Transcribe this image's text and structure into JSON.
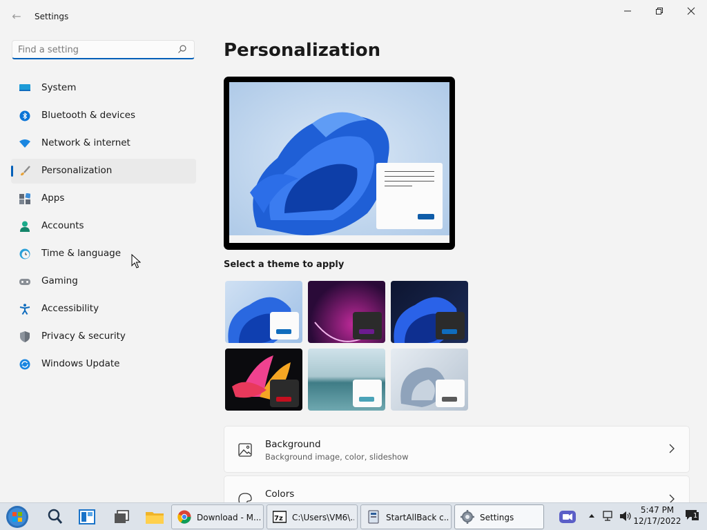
{
  "window": {
    "title": "Settings",
    "back_glyph": "←",
    "controls": {
      "minimize": "—",
      "maximize": "☐",
      "close": "✕"
    }
  },
  "search": {
    "placeholder": "Find a setting",
    "value": ""
  },
  "nav": {
    "items": [
      {
        "label": "System",
        "icon": "monitor-icon",
        "active": false
      },
      {
        "label": "Bluetooth & devices",
        "icon": "bluetooth-icon",
        "active": false
      },
      {
        "label": "Network & internet",
        "icon": "wifi-icon",
        "active": false
      },
      {
        "label": "Personalization",
        "icon": "brush-icon",
        "active": true
      },
      {
        "label": "Apps",
        "icon": "apps-icon",
        "active": false
      },
      {
        "label": "Accounts",
        "icon": "person-icon",
        "active": false
      },
      {
        "label": "Time & language",
        "icon": "clock-globe-icon",
        "active": false
      },
      {
        "label": "Gaming",
        "icon": "gamepad-icon",
        "active": false
      },
      {
        "label": "Accessibility",
        "icon": "accessibility-icon",
        "active": false
      },
      {
        "label": "Privacy & security",
        "icon": "shield-icon",
        "active": false
      },
      {
        "label": "Windows Update",
        "icon": "update-icon",
        "active": false
      }
    ]
  },
  "main": {
    "title": "Personalization",
    "themes_label": "Select a theme to apply",
    "themes": [
      {
        "name": "windows-light",
        "accent": "#0f6cbd"
      },
      {
        "name": "glow",
        "accent": "#6b1b8f"
      },
      {
        "name": "windows-dark",
        "accent": "#0f6cbd"
      },
      {
        "name": "captured-motion",
        "accent": "#c50f1f"
      },
      {
        "name": "sunrise",
        "accent": "#4aa3b8"
      },
      {
        "name": "flow",
        "accent": "#5a5a5a"
      }
    ],
    "cards": [
      {
        "title": "Background",
        "subtitle": "Background image, color, slideshow",
        "icon": "image-icon"
      },
      {
        "title": "Colors",
        "subtitle": "",
        "icon": "palette-icon"
      }
    ]
  },
  "taskbar": {
    "buttons": [
      {
        "label": "Download - M...",
        "icon": "chrome-icon"
      },
      {
        "label": "C:\\Users\\VM6\\...",
        "icon": "7zip-icon"
      },
      {
        "label": "StartAllBack c...",
        "icon": "startallback-icon"
      },
      {
        "label": "Settings",
        "icon": "gear-icon",
        "active": true
      }
    ],
    "clock": {
      "time": "5:47 PM",
      "date": "12/17/2022"
    },
    "notification_count": "1"
  },
  "colors": {
    "accent": "#005fb8",
    "background": "#f3f3f3"
  }
}
